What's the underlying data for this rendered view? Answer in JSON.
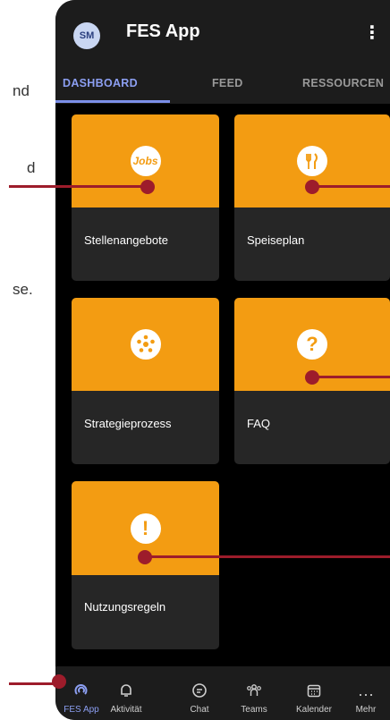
{
  "background_text": [
    "nd",
    "d",
    "se."
  ],
  "header": {
    "avatar_initials": "SM",
    "title": "FES App",
    "menu_icon": "kebab-menu-icon"
  },
  "tabs": [
    {
      "label": "DASHBOARD",
      "active": true
    },
    {
      "label": "FEED",
      "active": false
    },
    {
      "label": "RESSOURCEN",
      "active": false
    }
  ],
  "tiles": [
    {
      "label": "Stellenangebote",
      "icon": "jobs-icon",
      "icon_text": "Jobs"
    },
    {
      "label": "Speiseplan",
      "icon": "cutlery-icon"
    },
    {
      "label": "Strategieprozess",
      "icon": "network-icon"
    },
    {
      "label": "FAQ",
      "icon": "question-icon",
      "icon_text": "?"
    },
    {
      "label": "Nutzungsregeln",
      "icon": "exclamation-icon",
      "icon_text": "!"
    }
  ],
  "bottom_nav": [
    {
      "label": "FES App",
      "icon": "fes-app-icon",
      "active": true
    },
    {
      "label": "Aktivität",
      "icon": "bell-icon",
      "active": false
    },
    {
      "label": "Chat",
      "icon": "chat-icon",
      "active": false
    },
    {
      "label": "Teams",
      "icon": "teams-icon",
      "active": false
    },
    {
      "label": "Kalender",
      "icon": "calendar-icon",
      "active": false
    },
    {
      "label": "Mehr",
      "icon": "more-icon",
      "active": false
    }
  ],
  "colors": {
    "accent_orange": "#f39c12",
    "tab_active": "#8c9ff2",
    "callout": "#9d1c2b",
    "tile_bg": "#262626"
  }
}
